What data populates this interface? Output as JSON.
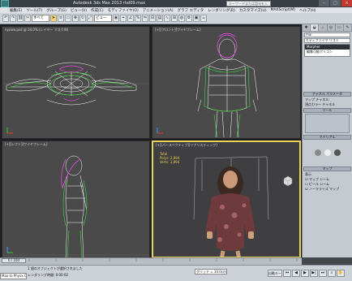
{
  "titlebar": {
    "title": "Autodesk 3ds Max 2013  rtal09.max",
    "search_placeholder": "キーワードまたは語句を入力",
    "min": "–",
    "max": "□",
    "close": "×"
  },
  "menubar": [
    "編集(E)",
    "ツール(T)",
    "グループ(G)",
    "ビュー(V)",
    "作成(C)",
    "モディファイヤ(O)",
    "アニメーション(A)",
    "グラフ エディタ",
    "レンダリング(R)",
    "カスタマイズ(U)",
    "MAXScript(M)",
    "ヘルプ(H)"
  ],
  "toolbar": {
    "filter": "すべて",
    "view": "ビュー",
    "icons": [
      "undo-icon",
      "redo-icon",
      "link-icon",
      "unlink-icon",
      "select-icon",
      "move-icon",
      "rotate-icon",
      "scale-icon"
    ]
  },
  "viewports": {
    "top_left": "[+][トップ][ワイヤフレーム]",
    "top_right": "[+][フロント][ワイヤフレーム]",
    "bottom_left": "[+][レフト][ワイヤフレーム]",
    "bottom_right": "[+][パースペクティブ][リアリスティック]",
    "file_label": "nyuwo.psd @ 24.0% (レイヤー マスク/8)"
  },
  "stats": {
    "total": "Total",
    "polys_label": "Polys:",
    "polys": "2,894",
    "verts_label": "Verts:",
    "verts": "2,894"
  },
  "command_panel": {
    "object_name": "mai",
    "modifier_list": "モディファイヤ リスト",
    "stack": [
      "Morpher",
      "編集可能ポリゴン"
    ],
    "section_channels": "チャネル パラメータ",
    "channel_text_1": "マップ チャネル:",
    "channel_text_2": "頂点カラー チャネル",
    "section_tools": "ツール",
    "section_material": "マテリアル",
    "section_map": "マップ",
    "display_label": "表示",
    "display_opts": [
      "マップ シーム",
      "ピール シーム"
    ],
    "normalize": "ノーマライズ マップ"
  },
  "timeline": {
    "slider": "0 / 100",
    "ticks": [
      "0",
      "10",
      "20",
      "30",
      "40",
      "50",
      "60",
      "70",
      "80",
      "90",
      "100"
    ]
  },
  "status": {
    "line1": "1 個のオブジェクトが選択されました",
    "line2": "レンダリング時間: 0:00:02",
    "maxscript": "Max to Physx C",
    "x_label": "X:",
    "grid": "グリッド = 10.0cm",
    "key": "自動キー"
  },
  "colors": {
    "accent_yellow": "#e8d45a",
    "wire_white": "#ffffff",
    "wire_green": "#33e033",
    "wire_magenta": "#e64be6"
  }
}
